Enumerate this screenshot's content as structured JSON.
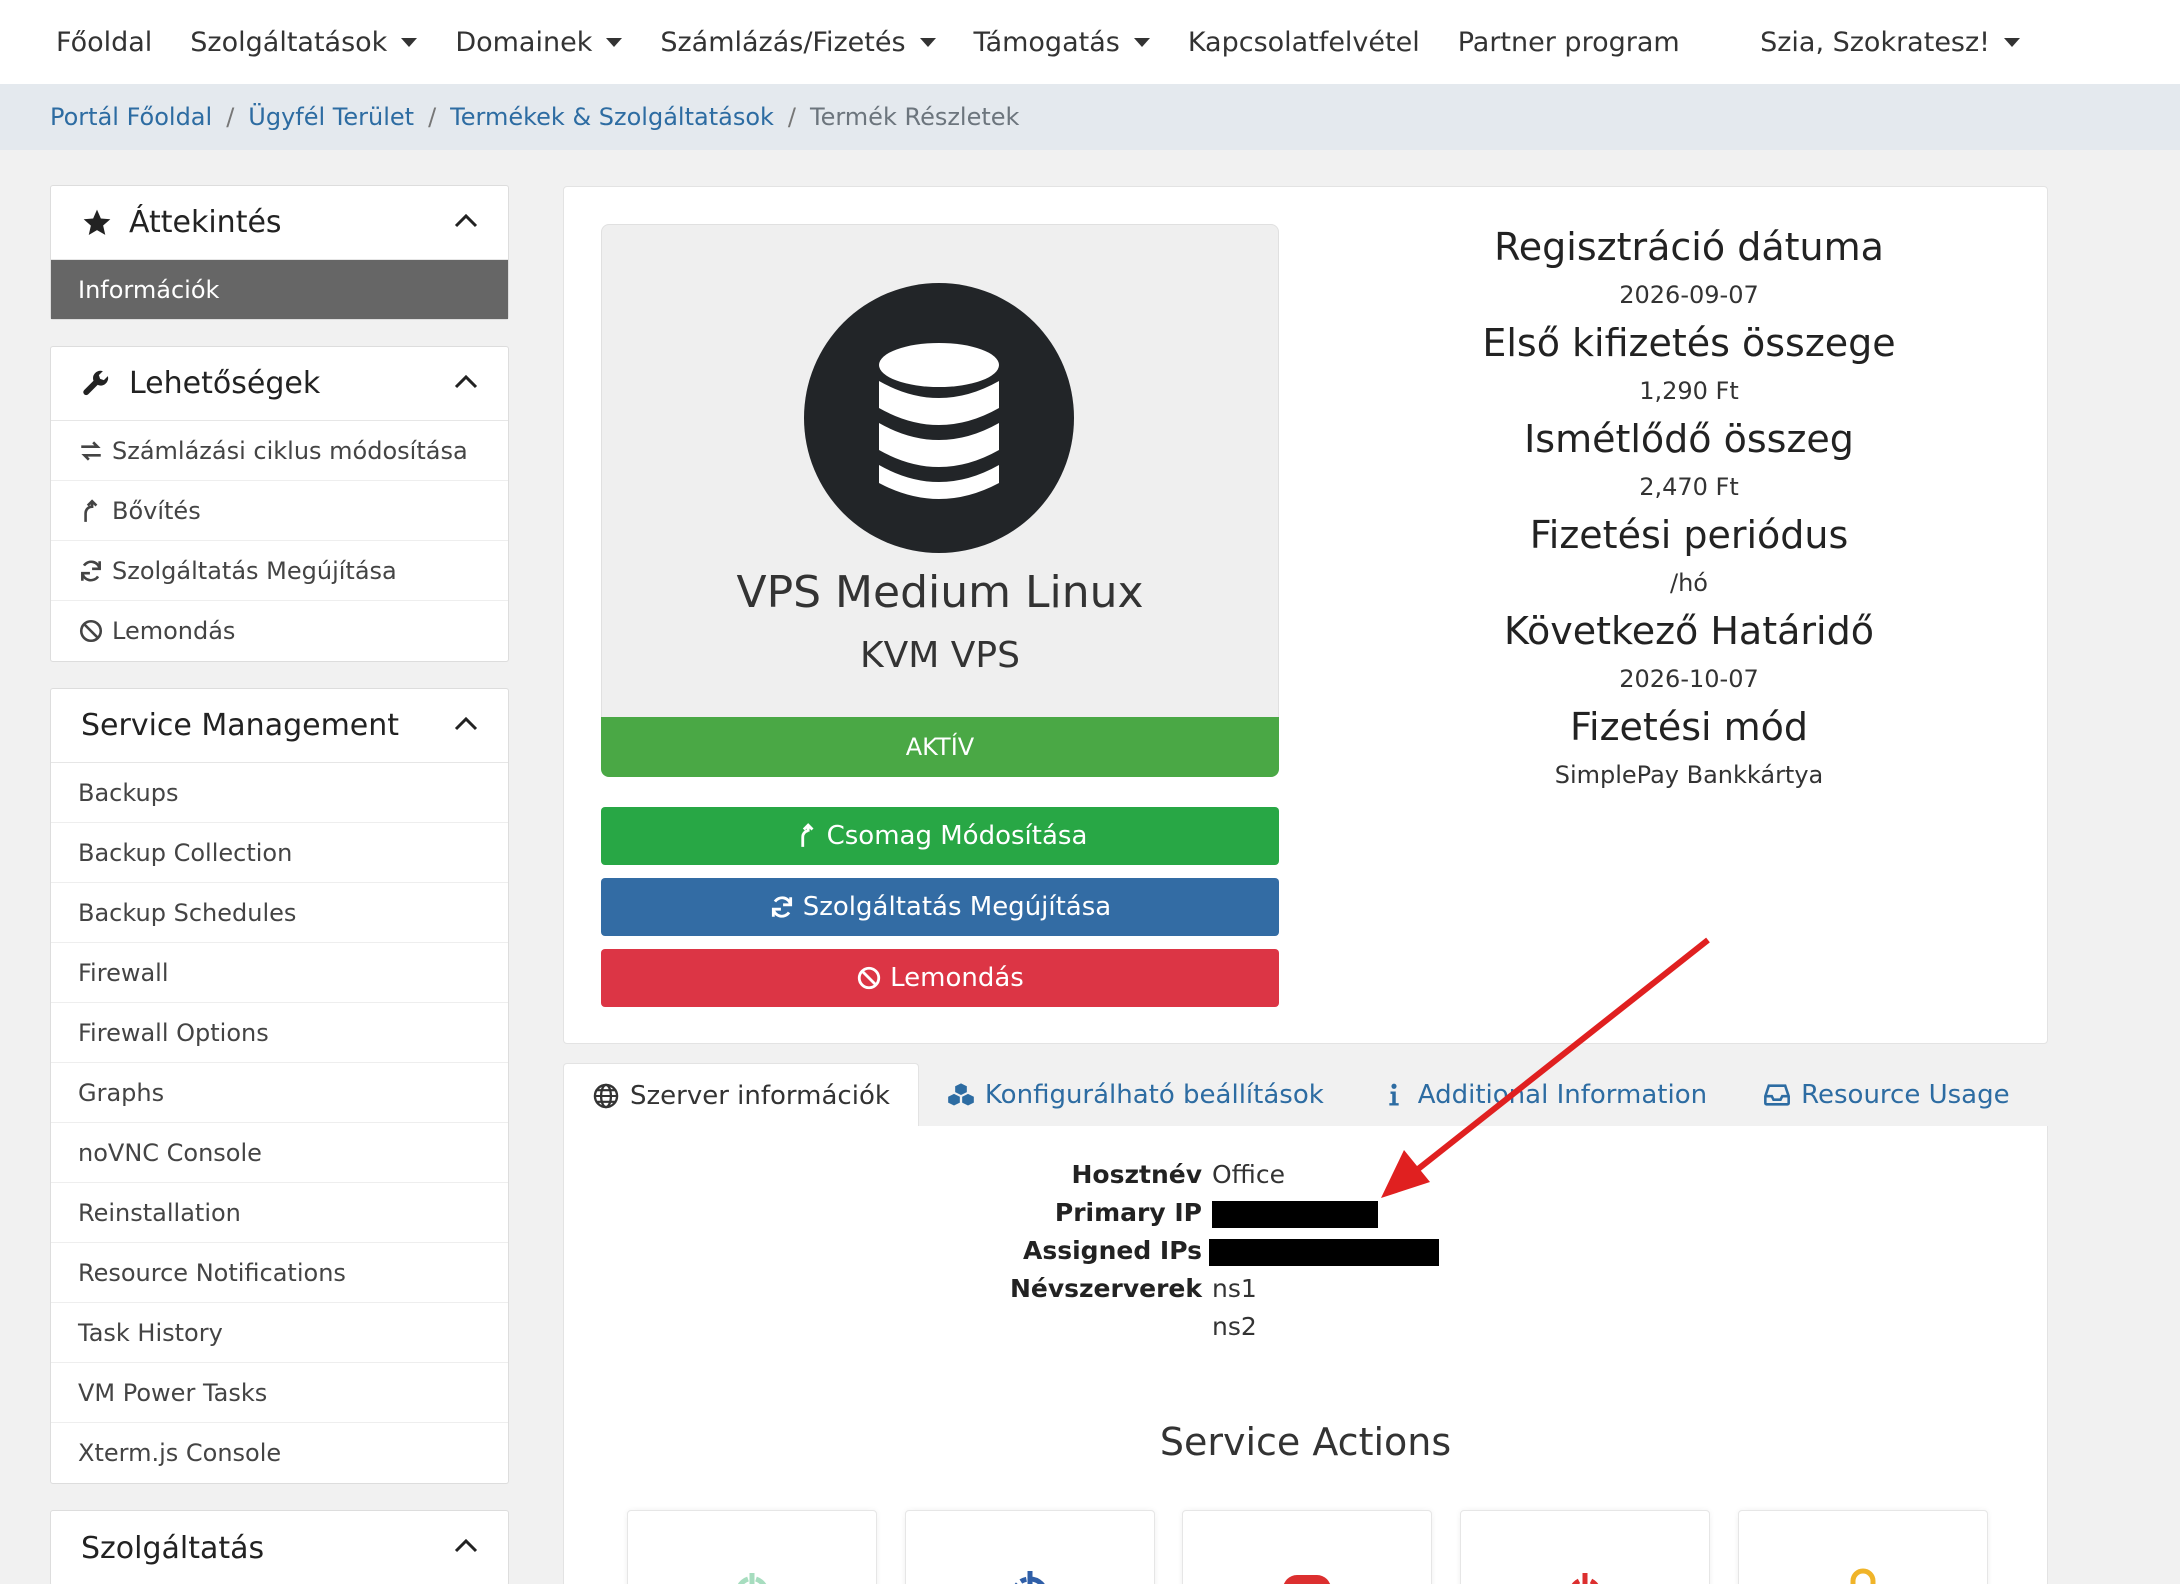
{
  "nav": {
    "items": [
      {
        "label": "Főoldal",
        "caret": false
      },
      {
        "label": "Szolgáltatások",
        "caret": true
      },
      {
        "label": "Domainek",
        "caret": true
      },
      {
        "label": "Számlázás/Fizetés",
        "caret": true
      },
      {
        "label": "Támogatás",
        "caret": true
      },
      {
        "label": "Kapcsolatfelvétel",
        "caret": false
      },
      {
        "label": "Partner program",
        "caret": false
      }
    ],
    "user": "Szia, Szokratesz!"
  },
  "breadcrumb": {
    "links": [
      "Portál Főoldal",
      "Ügyfél Terület",
      "Termékek & Szolgáltatások"
    ],
    "separator": "/",
    "current": "Termék Részletek"
  },
  "sidebar": {
    "overview": {
      "title": "Áttekintés",
      "icon": "star-icon",
      "items": [
        "Információk"
      ]
    },
    "options": {
      "title": "Lehetőségek",
      "icon": "wrench-icon",
      "items": [
        {
          "label": "Számlázási ciklus módosítása",
          "icon": "exchange-icon"
        },
        {
          "label": "Bővítés",
          "icon": "upgrade-arrow-icon"
        },
        {
          "label": "Szolgáltatás Megújítása",
          "icon": "sync-icon"
        },
        {
          "label": "Lemondás",
          "icon": "ban-icon"
        }
      ]
    },
    "service_management": {
      "title": "Service Management",
      "items": [
        "Backups",
        "Backup Collection",
        "Backup Schedules",
        "Firewall",
        "Firewall Options",
        "Graphs",
        "noVNC Console",
        "Reinstallation",
        "Resource Notifications",
        "Task History",
        "VM Power Tasks",
        "Xterm.js Console"
      ]
    },
    "service": {
      "title": "Szolgáltatás"
    }
  },
  "product": {
    "name": "VPS Medium Linux",
    "group": "KVM VPS",
    "icon": "database-icon",
    "status": "AKTÍV",
    "buttons": {
      "upgrade": "Csomag Módosítása",
      "renew": "Szolgáltatás Megújítása",
      "cancel": "Lemondás"
    }
  },
  "info": {
    "reg_date_label": "Regisztráció dátuma",
    "reg_date": "2026-09-07",
    "first_payment_label": "Első kifizetés összege",
    "first_payment": "1,290 Ft",
    "recurring_label": "Ismétlődő összeg",
    "recurring": "2,470 Ft",
    "billing_cycle_label": "Fizetési periódus",
    "billing_cycle": "/hó",
    "next_due_label": "Következő Határidő",
    "next_due": "2026-10-07",
    "payment_method_label": "Fizetési mód",
    "payment_method": "SimplePay Bankkártya"
  },
  "tabs": [
    {
      "label": "Szerver információk",
      "icon": "globe-icon",
      "active": true
    },
    {
      "label": "Konfigurálható beállítások",
      "icon": "cubes-icon",
      "active": false
    },
    {
      "label": "Additional Information",
      "icon": "info-icon",
      "active": false
    },
    {
      "label": "Resource Usage",
      "icon": "inbox-icon",
      "active": false
    }
  ],
  "server": {
    "hostname_label": "Hosztnév",
    "hostname": "Office",
    "primary_ip_label": "Primary IP",
    "assigned_ips_label": "Assigned IPs",
    "nameservers_label": "Névszerverek",
    "ns1": "ns1",
    "ns2": "ns2"
  },
  "service_actions": {
    "title": "Service Actions",
    "tiles": [
      {
        "icon": "power-on-icon",
        "color": "#3cb371"
      },
      {
        "icon": "reboot-icon",
        "color": "#2f5fa8"
      },
      {
        "icon": "stop-icon",
        "color": "#dc2f2f"
      },
      {
        "icon": "power-off-icon",
        "color": "#dc2f2f"
      },
      {
        "icon": "lock-icon",
        "color": "#f0b429"
      }
    ]
  },
  "colors": {
    "link": "#2d6ca2",
    "status_active": "#4aa845",
    "btn_green": "#28a745",
    "btn_blue": "#336ca4",
    "btn_red": "#dc3545",
    "annotation_arrow": "#e02020"
  }
}
